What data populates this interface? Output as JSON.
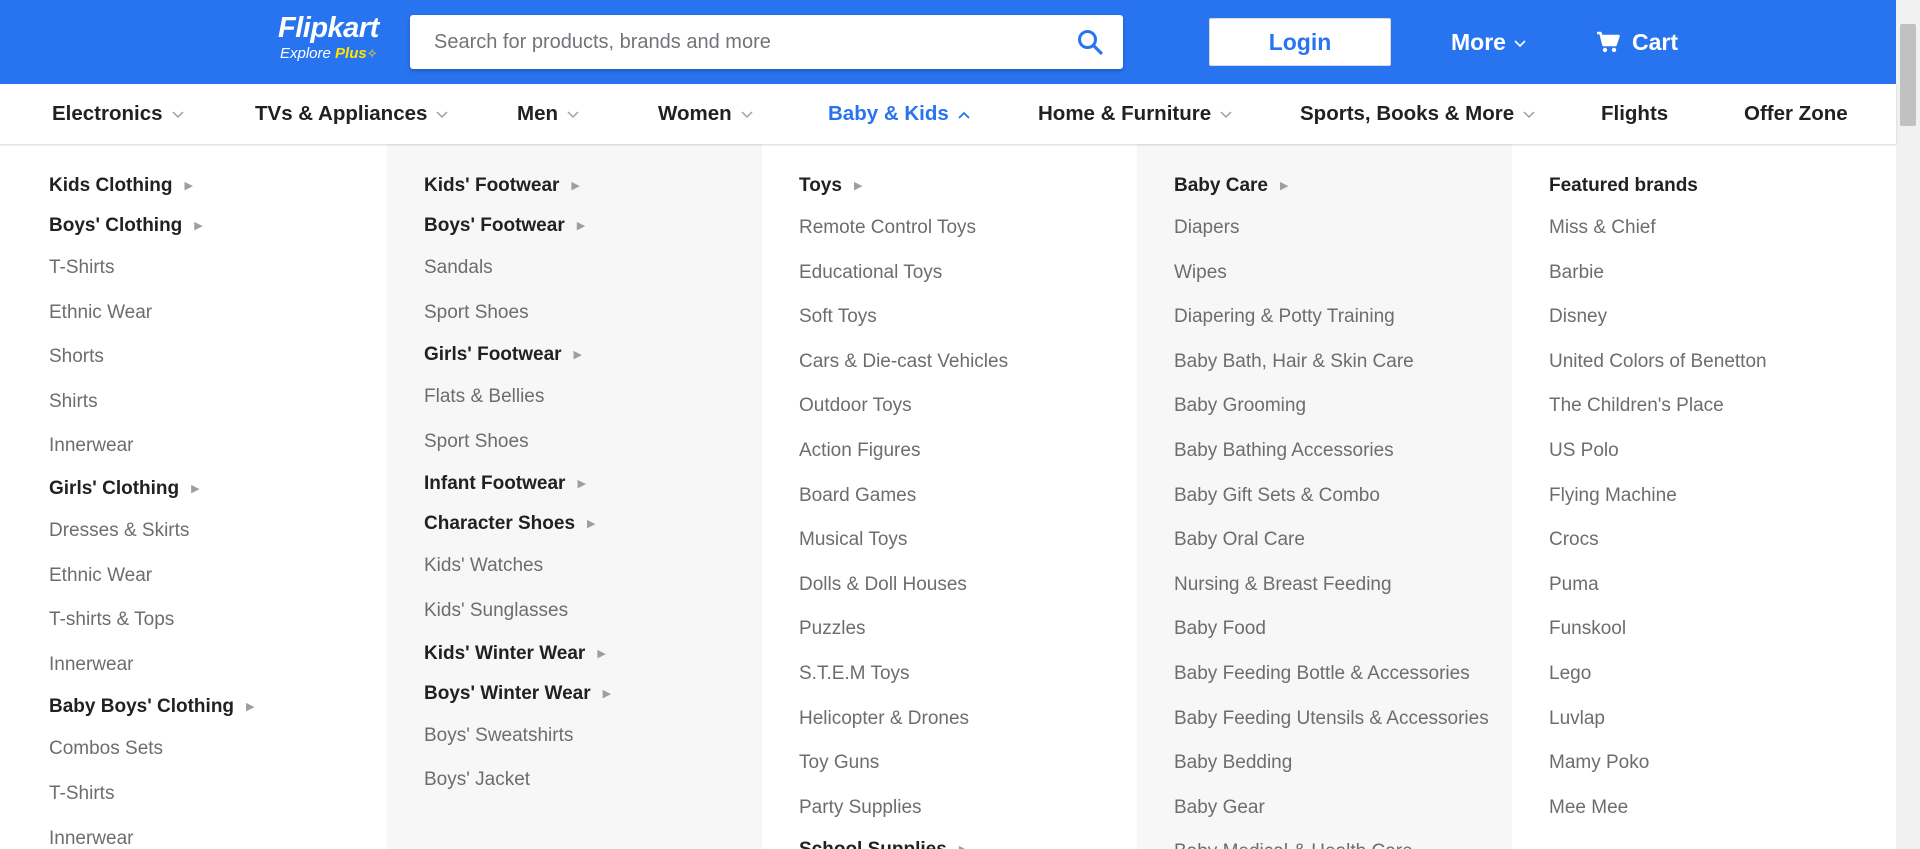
{
  "header": {
    "logo": {
      "name": "Flipkart",
      "tagline": "Explore",
      "tagline_highlight": "Plus",
      "tagline_icon": "✧"
    },
    "search": {
      "placeholder": "Search for products, brands and more",
      "value": "",
      "icon": "search-icon"
    },
    "login_label": "Login",
    "more_label": "More",
    "cart_label": "Cart",
    "colors": {
      "brand": "#2874f0",
      "accent": "#ffe500"
    }
  },
  "categories": [
    {
      "label": "Electronics",
      "has_dropdown": true
    },
    {
      "label": "TVs & Appliances",
      "has_dropdown": true
    },
    {
      "label": "Men",
      "has_dropdown": true
    },
    {
      "label": "Women",
      "has_dropdown": true
    },
    {
      "label": "Baby & Kids",
      "has_dropdown": true,
      "active": true
    },
    {
      "label": "Home & Furniture",
      "has_dropdown": true
    },
    {
      "label": "Sports, Books & More",
      "has_dropdown": true
    },
    {
      "label": "Flights",
      "has_dropdown": false
    },
    {
      "label": "Offer Zone",
      "has_dropdown": false
    }
  ],
  "menu": {
    "columns": [
      {
        "entries": [
          {
            "label": "Kids Clothing",
            "type": "heading",
            "arrow": true
          },
          {
            "label": "Boys' Clothing",
            "type": "heading",
            "arrow": true
          },
          {
            "label": "T-Shirts",
            "type": "link"
          },
          {
            "label": "Ethnic Wear",
            "type": "link"
          },
          {
            "label": "Shorts",
            "type": "link"
          },
          {
            "label": "Shirts",
            "type": "link"
          },
          {
            "label": "Innerwear",
            "type": "link"
          },
          {
            "label": "Girls' Clothing",
            "type": "heading",
            "arrow": true
          },
          {
            "label": "Dresses & Skirts",
            "type": "link"
          },
          {
            "label": "Ethnic Wear",
            "type": "link"
          },
          {
            "label": "T-shirts & Tops",
            "type": "link"
          },
          {
            "label": "Innerwear",
            "type": "link"
          },
          {
            "label": "Baby Boys' Clothing",
            "type": "heading",
            "arrow": true
          },
          {
            "label": "Combos Sets",
            "type": "link"
          },
          {
            "label": "T-Shirts",
            "type": "link"
          },
          {
            "label": "Innerwear",
            "type": "link"
          }
        ]
      },
      {
        "entries": [
          {
            "label": "Kids' Footwear",
            "type": "heading",
            "arrow": true
          },
          {
            "label": "Boys' Footwear",
            "type": "heading",
            "arrow": true
          },
          {
            "label": "Sandals",
            "type": "link"
          },
          {
            "label": "Sport Shoes",
            "type": "link"
          },
          {
            "label": "Girls' Footwear",
            "type": "heading",
            "arrow": true
          },
          {
            "label": "Flats & Bellies",
            "type": "link"
          },
          {
            "label": "Sport Shoes",
            "type": "link"
          },
          {
            "label": "Infant Footwear",
            "type": "heading",
            "arrow": true
          },
          {
            "label": "Character Shoes",
            "type": "heading",
            "arrow": true
          },
          {
            "label": "Kids' Watches",
            "type": "link"
          },
          {
            "label": "Kids' Sunglasses",
            "type": "link"
          },
          {
            "label": "Kids' Winter Wear",
            "type": "heading",
            "arrow": true
          },
          {
            "label": "Boys' Winter Wear",
            "type": "heading",
            "arrow": true
          },
          {
            "label": "Boys' Sweatshirts",
            "type": "link"
          },
          {
            "label": "Boys' Jacket",
            "type": "link"
          }
        ]
      },
      {
        "entries": [
          {
            "label": "Toys",
            "type": "heading",
            "arrow": true
          },
          {
            "label": "Remote Control Toys",
            "type": "link"
          },
          {
            "label": "Educational Toys",
            "type": "link"
          },
          {
            "label": "Soft Toys",
            "type": "link"
          },
          {
            "label": "Cars & Die-cast Vehicles",
            "type": "link"
          },
          {
            "label": "Outdoor Toys",
            "type": "link"
          },
          {
            "label": "Action Figures",
            "type": "link"
          },
          {
            "label": "Board Games",
            "type": "link"
          },
          {
            "label": "Musical Toys",
            "type": "link"
          },
          {
            "label": "Dolls & Doll Houses",
            "type": "link"
          },
          {
            "label": "Puzzles",
            "type": "link"
          },
          {
            "label": "S.T.E.M Toys",
            "type": "link"
          },
          {
            "label": "Helicopter & Drones",
            "type": "link"
          },
          {
            "label": "Toy Guns",
            "type": "link"
          },
          {
            "label": "Party Supplies",
            "type": "link"
          },
          {
            "label": "School Supplies",
            "type": "heading",
            "arrow": true
          }
        ]
      },
      {
        "entries": [
          {
            "label": "Baby Care",
            "type": "heading",
            "arrow": true
          },
          {
            "label": "Diapers",
            "type": "link"
          },
          {
            "label": "Wipes",
            "type": "link"
          },
          {
            "label": "Diapering & Potty Training",
            "type": "link"
          },
          {
            "label": "Baby Bath, Hair & Skin Care",
            "type": "link"
          },
          {
            "label": "Baby Grooming",
            "type": "link"
          },
          {
            "label": "Baby Bathing Accessories",
            "type": "link"
          },
          {
            "label": "Baby Gift Sets & Combo",
            "type": "link"
          },
          {
            "label": "Baby Oral Care",
            "type": "link"
          },
          {
            "label": "Nursing & Breast Feeding",
            "type": "link"
          },
          {
            "label": "Baby Food",
            "type": "link"
          },
          {
            "label": "Baby Feeding Bottle & Accessories",
            "type": "link"
          },
          {
            "label": "Baby Feeding Utensils & Accessories",
            "type": "link"
          },
          {
            "label": "Baby Bedding",
            "type": "link"
          },
          {
            "label": "Baby Gear",
            "type": "link"
          },
          {
            "label": "Baby Medical & Health Care",
            "type": "link"
          }
        ]
      },
      {
        "entries": [
          {
            "label": "Featured brands",
            "type": "heading",
            "arrow": false
          },
          {
            "label": "Miss & Chief",
            "type": "link"
          },
          {
            "label": "Barbie",
            "type": "link"
          },
          {
            "label": "Disney",
            "type": "link"
          },
          {
            "label": "United Colors of Benetton",
            "type": "link"
          },
          {
            "label": "The Children's Place",
            "type": "link"
          },
          {
            "label": "US Polo",
            "type": "link"
          },
          {
            "label": "Flying Machine",
            "type": "link"
          },
          {
            "label": "Crocs",
            "type": "link"
          },
          {
            "label": "Puma",
            "type": "link"
          },
          {
            "label": "Funskool",
            "type": "link"
          },
          {
            "label": "Lego",
            "type": "link"
          },
          {
            "label": "Luvlap",
            "type": "link"
          },
          {
            "label": "Mamy Poko",
            "type": "link"
          },
          {
            "label": "Mee Mee",
            "type": "link"
          }
        ]
      }
    ]
  }
}
